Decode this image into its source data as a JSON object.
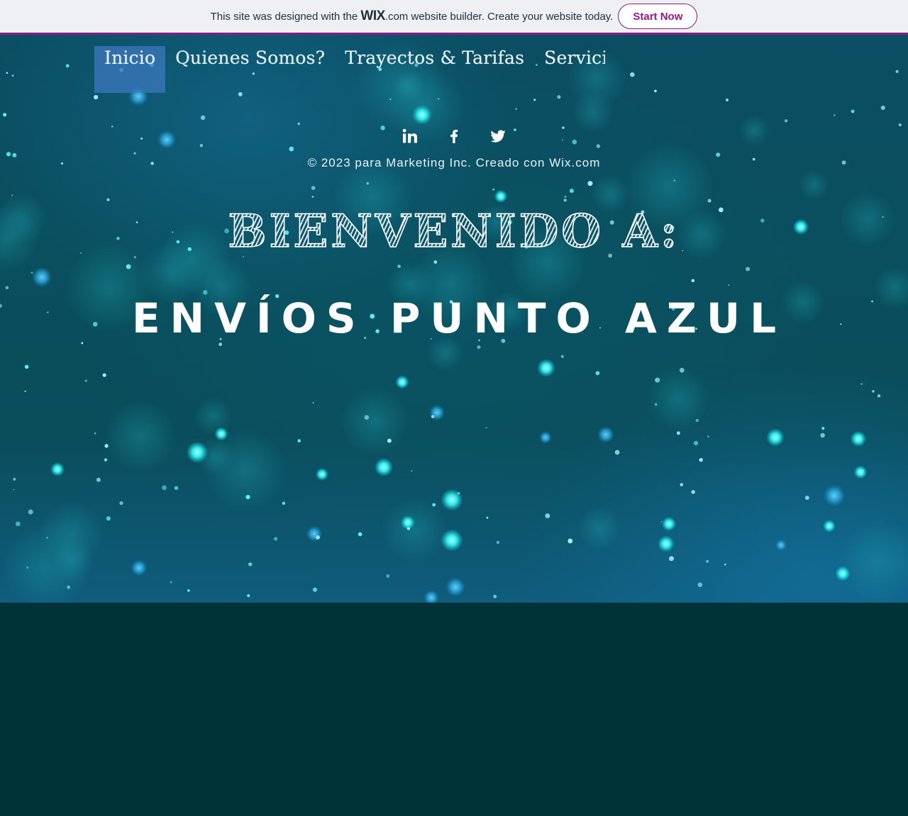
{
  "wix_banner": {
    "text_before": "This site was designed with the",
    "logo_main": "WIX",
    "logo_suffix": ".com",
    "text_after": "website builder. Create your website today.",
    "button_label": "Start Now",
    "accent_color": "#8d1a86"
  },
  "nav": {
    "items": [
      {
        "label": "Inicio",
        "active": true
      },
      {
        "label": "Quienes Somos?",
        "active": false
      },
      {
        "label": "Trayectos & Tarifas",
        "active": false
      },
      {
        "label": "Servicios Empresariales",
        "active": false
      }
    ]
  },
  "social": {
    "icons": [
      {
        "name": "linkedin-icon"
      },
      {
        "name": "facebook-icon"
      },
      {
        "name": "twitter-icon"
      }
    ]
  },
  "footer_text": "© 2023 para Marketing Inc. Creado con Wix.com",
  "hero": {
    "welcome": "BIENVENIDO A:",
    "brand": "ENVÍOS PUNTO AZUL"
  },
  "colors": {
    "hero_dark": "#0a4d5b",
    "hero_light": "#0f5c7c",
    "lower_bg": "#003337",
    "bokeh_cyan": "#2ff3f3",
    "bokeh_blue": "#3ab6e8",
    "nav_active_bg": "#3c78be"
  }
}
